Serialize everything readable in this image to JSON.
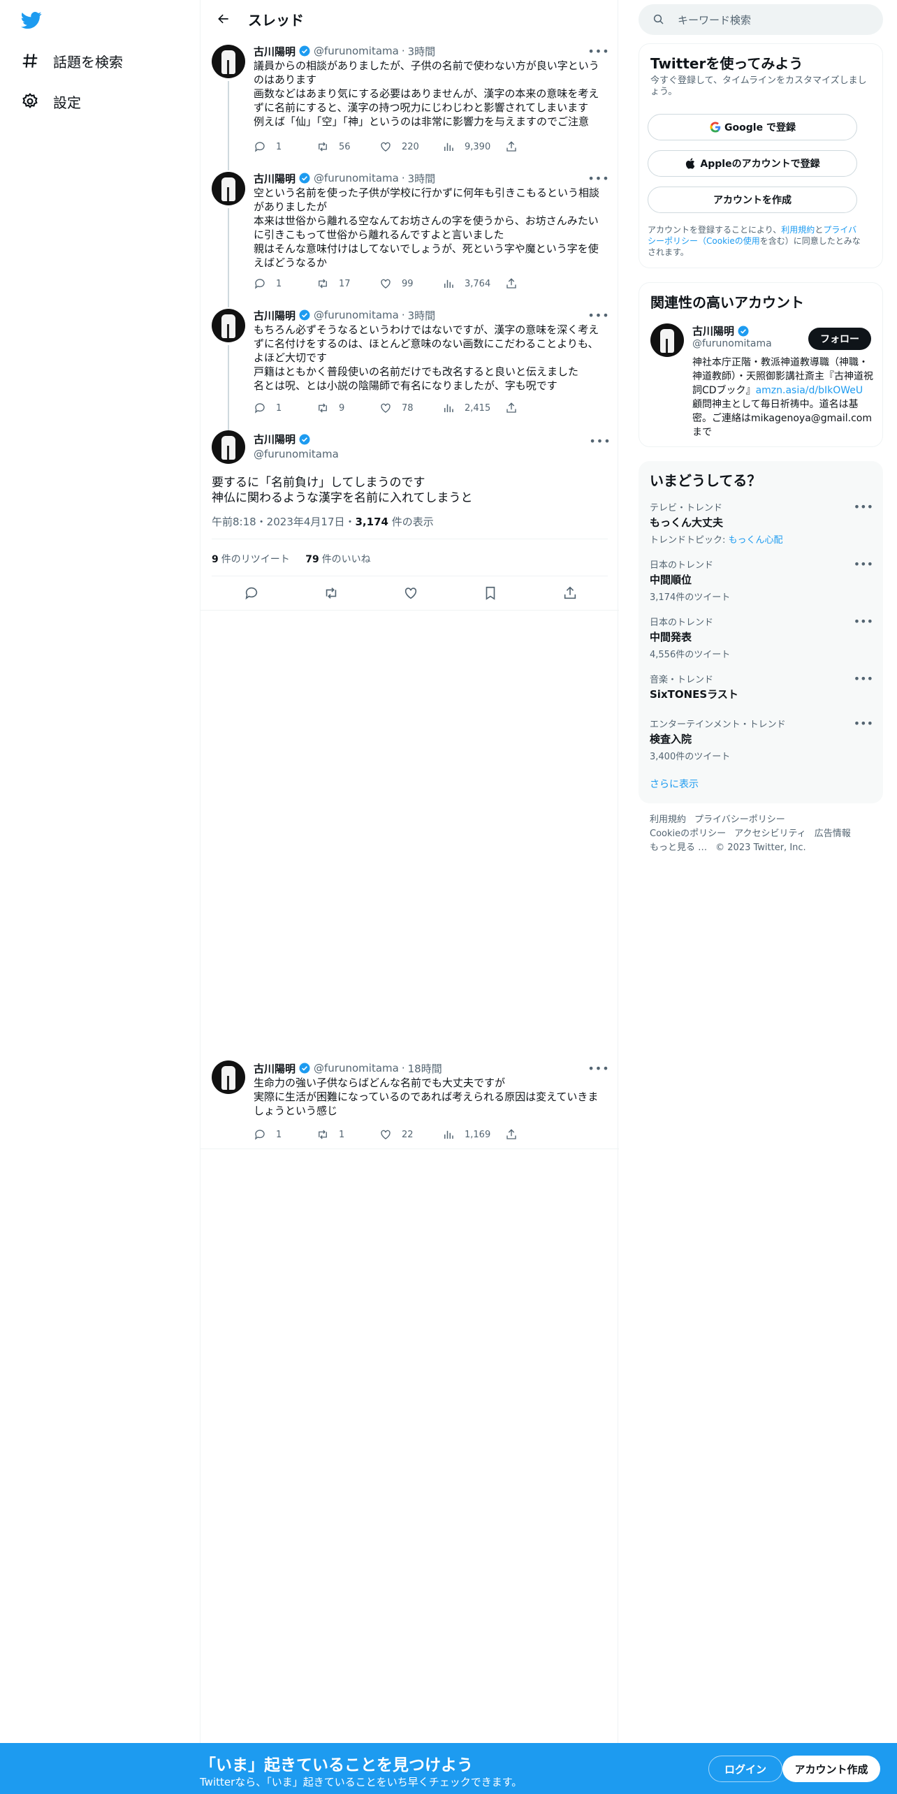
{
  "sidebar": {
    "items": [
      {
        "label": "話題を検索"
      },
      {
        "label": "設定"
      }
    ]
  },
  "header": {
    "title": "スレッド"
  },
  "tweets": [
    {
      "name": "古川陽明",
      "handle": "@furunomitama",
      "time": "3時間",
      "text": "議員からの相談がありましたが、子供の名前で使わない方が良い字というのはあります\n画数などはあまり気にする必要はありませんが、漢字の本来の意味を考えずに名前にすると、漢字の持つ呪力にじわじわと影響されてしまいます\n例えば「仙」「空」「神」というのは非常に影響力を与えますのでご注意",
      "replies": "1",
      "retweets": "56",
      "likes": "220",
      "views": "9,390"
    },
    {
      "name": "古川陽明",
      "handle": "@furunomitama",
      "time": "3時間",
      "text": "空という名前を使った子供が学校に行かずに何年も引きこもるという相談がありましたが\n本来は世俗から離れる空なんてお坊さんの字を使うから、お坊さんみたいに引きこもって世俗から離れるんですよと言いました\n親はそんな意味付けはしてないでしょうが、死という字や魔という字を使えばどうなるか",
      "replies": "1",
      "retweets": "17",
      "likes": "99",
      "views": "3,764"
    },
    {
      "name": "古川陽明",
      "handle": "@furunomitama",
      "time": "3時間",
      "text": "もちろん必ずそうなるというわけではないですが、漢字の意味を深く考えずに名付けをするのは、ほとんど意味のない画数にこだわることよりも、よほど大切です\n戸籍はともかく普段使いの名前だけでも改名すると良いと伝えました\n名とは呪、とは小説の陰陽師で有名になりましたが、字も呪です",
      "replies": "1",
      "retweets": "9",
      "likes": "78",
      "views": "2,415"
    }
  ],
  "focus": {
    "name": "古川陽明",
    "handle": "@furunomitama",
    "text": "要するに「名前負け」してしまうのです\n神仏に関わるような漢字を名前に入れてしまうと",
    "timestamp": "午前8:18・2023年4月17日・",
    "views_count": "3,174",
    "views_label": "件の表示",
    "retweets_count": "9",
    "retweets_label": "件のリツイート",
    "likes_count": "79",
    "likes_label": "件のいいね"
  },
  "reply": {
    "name": "古川陽明",
    "handle": "@furunomitama",
    "time": "18時間",
    "text": "生命力の強い子供ならばどんな名前でも大丈夫ですが\n実際に生活が困難になっているのであれば考えられる原因は変えていきましょうという感じ",
    "replies": "1",
    "retweets": "1",
    "likes": "22",
    "views": "1,169"
  },
  "search": {
    "placeholder": "キーワード検索"
  },
  "signup_card": {
    "title": "Twitterを使ってみよう",
    "subtitle": "今すぐ登録して、タイムラインをカスタマイズしましょう。",
    "google": "Google で登録",
    "apple": "Appleのアカウントで登録",
    "create": "アカウントを作成",
    "terms_1": "アカウントを登録することにより、",
    "terms_link1": "利用規約",
    "terms_2": "と",
    "terms_link2": "プライバシーポリシー（Cookieの使用",
    "terms_3": "を含む）に同意したとみなされます。"
  },
  "related": {
    "title": "関連性の高いアカウント",
    "name": "古川陽明",
    "handle": "@furunomitama",
    "follow": "フォロー",
    "bio_1": "神社本庁正階・教派神道教導職（神職・神道教師）・天照御影講社斎主『古神道祝詞CDブック』",
    "bio_link": "amzn.asia/d/bIkOWeU",
    "bio_2": " 顧問神主として毎日祈祷中。道名は基密。ご連絡はmikagenoya@gmail.comまで"
  },
  "trends": {
    "title": "いまどうしてる？",
    "items": [
      {
        "category": "テレビ・トレンド",
        "name": "もっくん大丈夫",
        "extra_label": "トレンドトピック: ",
        "extra_link": "もっくん心配"
      },
      {
        "category": "日本のトレンド",
        "name": "中間順位",
        "count": "3,174件のツイート"
      },
      {
        "category": "日本のトレンド",
        "name": "中間発表",
        "count": "4,556件のツイート"
      },
      {
        "category": "音楽・トレンド",
        "name": "SixTONESラスト"
      },
      {
        "category": "エンターテインメント・トレンド",
        "name": "検査入院",
        "count": "3,400件のツイート"
      }
    ],
    "show_more": "さらに表示"
  },
  "footer": {
    "links": [
      "利用規約",
      "プライバシーポリシー",
      "Cookieのポリシー",
      "アクセシビリティ",
      "広告情報",
      "もっと見る …"
    ],
    "copyright": "© 2023 Twitter, Inc."
  },
  "bottom_bar": {
    "title": "「いま」起きていることを見つけよう",
    "subtitle": "Twitterなら、「いま」起きていることをいち早くチェックできます。",
    "login": "ログイン",
    "signup": "アカウント作成"
  },
  "colors": {
    "accent": "#1d9bf0",
    "text": "#0f1419",
    "secondary": "#536471"
  }
}
